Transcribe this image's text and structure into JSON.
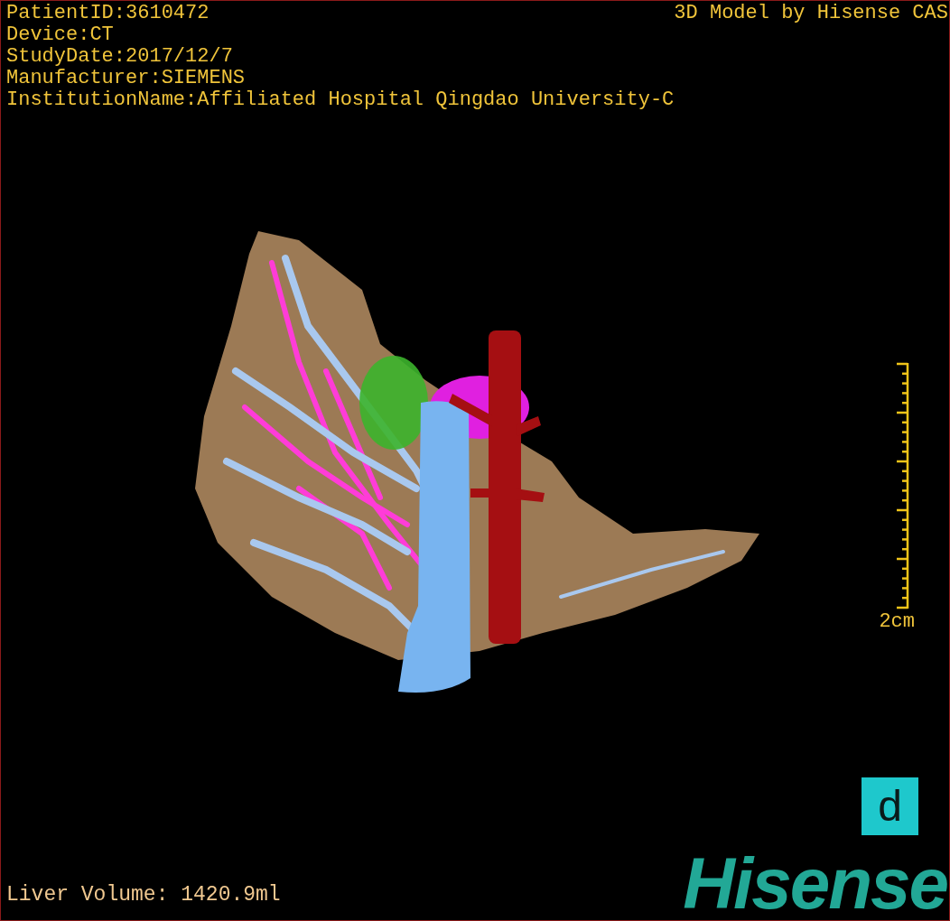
{
  "header": {
    "info_lines": [
      "PatientID:3610472",
      "Device:CT",
      "StudyDate:2017/12/7",
      "Manufacturer:SIEMENS",
      "InstitutionName:Affiliated Hospital Qingdao University-C"
    ],
    "title": "3D Model by Hisense CAS"
  },
  "scale_bar": {
    "label": "2cm"
  },
  "measurement": "Liver Volume: 1420.9ml",
  "badge": "d",
  "logo": "Hisense"
}
